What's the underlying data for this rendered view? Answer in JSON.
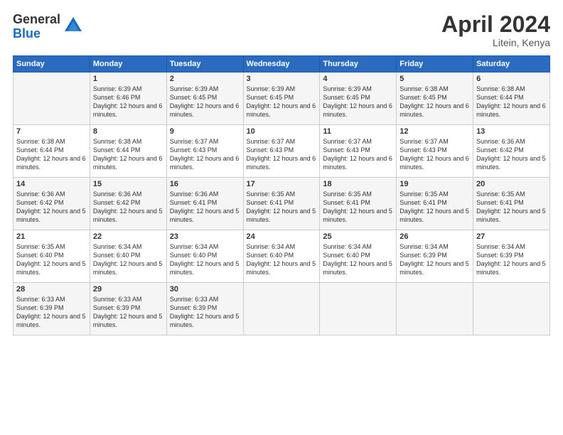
{
  "logo": {
    "general": "General",
    "blue": "Blue"
  },
  "title": "April 2024",
  "location": "Litein, Kenya",
  "weekdays": [
    "Sunday",
    "Monday",
    "Tuesday",
    "Wednesday",
    "Thursday",
    "Friday",
    "Saturday"
  ],
  "weeks": [
    [
      {
        "day": "",
        "sunrise": "",
        "sunset": "",
        "daylight": ""
      },
      {
        "day": "1",
        "sunrise": "Sunrise: 6:39 AM",
        "sunset": "Sunset: 6:46 PM",
        "daylight": "Daylight: 12 hours and 6 minutes."
      },
      {
        "day": "2",
        "sunrise": "Sunrise: 6:39 AM",
        "sunset": "Sunset: 6:45 PM",
        "daylight": "Daylight: 12 hours and 6 minutes."
      },
      {
        "day": "3",
        "sunrise": "Sunrise: 6:39 AM",
        "sunset": "Sunset: 6:45 PM",
        "daylight": "Daylight: 12 hours and 6 minutes."
      },
      {
        "day": "4",
        "sunrise": "Sunrise: 6:39 AM",
        "sunset": "Sunset: 6:45 PM",
        "daylight": "Daylight: 12 hours and 6 minutes."
      },
      {
        "day": "5",
        "sunrise": "Sunrise: 6:38 AM",
        "sunset": "Sunset: 6:45 PM",
        "daylight": "Daylight: 12 hours and 6 minutes."
      },
      {
        "day": "6",
        "sunrise": "Sunrise: 6:38 AM",
        "sunset": "Sunset: 6:44 PM",
        "daylight": "Daylight: 12 hours and 6 minutes."
      }
    ],
    [
      {
        "day": "7",
        "sunrise": "Sunrise: 6:38 AM",
        "sunset": "Sunset: 6:44 PM",
        "daylight": "Daylight: 12 hours and 6 minutes."
      },
      {
        "day": "8",
        "sunrise": "Sunrise: 6:38 AM",
        "sunset": "Sunset: 6:44 PM",
        "daylight": "Daylight: 12 hours and 6 minutes."
      },
      {
        "day": "9",
        "sunrise": "Sunrise: 6:37 AM",
        "sunset": "Sunset: 6:43 PM",
        "daylight": "Daylight: 12 hours and 6 minutes."
      },
      {
        "day": "10",
        "sunrise": "Sunrise: 6:37 AM",
        "sunset": "Sunset: 6:43 PM",
        "daylight": "Daylight: 12 hours and 6 minutes."
      },
      {
        "day": "11",
        "sunrise": "Sunrise: 6:37 AM",
        "sunset": "Sunset: 6:43 PM",
        "daylight": "Daylight: 12 hours and 6 minutes."
      },
      {
        "day": "12",
        "sunrise": "Sunrise: 6:37 AM",
        "sunset": "Sunset: 6:43 PM",
        "daylight": "Daylight: 12 hours and 6 minutes."
      },
      {
        "day": "13",
        "sunrise": "Sunrise: 6:36 AM",
        "sunset": "Sunset: 6:42 PM",
        "daylight": "Daylight: 12 hours and 5 minutes."
      }
    ],
    [
      {
        "day": "14",
        "sunrise": "Sunrise: 6:36 AM",
        "sunset": "Sunset: 6:42 PM",
        "daylight": "Daylight: 12 hours and 5 minutes."
      },
      {
        "day": "15",
        "sunrise": "Sunrise: 6:36 AM",
        "sunset": "Sunset: 6:42 PM",
        "daylight": "Daylight: 12 hours and 5 minutes."
      },
      {
        "day": "16",
        "sunrise": "Sunrise: 6:36 AM",
        "sunset": "Sunset: 6:41 PM",
        "daylight": "Daylight: 12 hours and 5 minutes."
      },
      {
        "day": "17",
        "sunrise": "Sunrise: 6:35 AM",
        "sunset": "Sunset: 6:41 PM",
        "daylight": "Daylight: 12 hours and 5 minutes."
      },
      {
        "day": "18",
        "sunrise": "Sunrise: 6:35 AM",
        "sunset": "Sunset: 6:41 PM",
        "daylight": "Daylight: 12 hours and 5 minutes."
      },
      {
        "day": "19",
        "sunrise": "Sunrise: 6:35 AM",
        "sunset": "Sunset: 6:41 PM",
        "daylight": "Daylight: 12 hours and 5 minutes."
      },
      {
        "day": "20",
        "sunrise": "Sunrise: 6:35 AM",
        "sunset": "Sunset: 6:41 PM",
        "daylight": "Daylight: 12 hours and 5 minutes."
      }
    ],
    [
      {
        "day": "21",
        "sunrise": "Sunrise: 6:35 AM",
        "sunset": "Sunset: 6:40 PM",
        "daylight": "Daylight: 12 hours and 5 minutes."
      },
      {
        "day": "22",
        "sunrise": "Sunrise: 6:34 AM",
        "sunset": "Sunset: 6:40 PM",
        "daylight": "Daylight: 12 hours and 5 minutes."
      },
      {
        "day": "23",
        "sunrise": "Sunrise: 6:34 AM",
        "sunset": "Sunset: 6:40 PM",
        "daylight": "Daylight: 12 hours and 5 minutes."
      },
      {
        "day": "24",
        "sunrise": "Sunrise: 6:34 AM",
        "sunset": "Sunset: 6:40 PM",
        "daylight": "Daylight: 12 hours and 5 minutes."
      },
      {
        "day": "25",
        "sunrise": "Sunrise: 6:34 AM",
        "sunset": "Sunset: 6:40 PM",
        "daylight": "Daylight: 12 hours and 5 minutes."
      },
      {
        "day": "26",
        "sunrise": "Sunrise: 6:34 AM",
        "sunset": "Sunset: 6:39 PM",
        "daylight": "Daylight: 12 hours and 5 minutes."
      },
      {
        "day": "27",
        "sunrise": "Sunrise: 6:34 AM",
        "sunset": "Sunset: 6:39 PM",
        "daylight": "Daylight: 12 hours and 5 minutes."
      }
    ],
    [
      {
        "day": "28",
        "sunrise": "Sunrise: 6:33 AM",
        "sunset": "Sunset: 6:39 PM",
        "daylight": "Daylight: 12 hours and 5 minutes."
      },
      {
        "day": "29",
        "sunrise": "Sunrise: 6:33 AM",
        "sunset": "Sunset: 6:39 PM",
        "daylight": "Daylight: 12 hours and 5 minutes."
      },
      {
        "day": "30",
        "sunrise": "Sunrise: 6:33 AM",
        "sunset": "Sunset: 6:39 PM",
        "daylight": "Daylight: 12 hours and 5 minutes."
      },
      {
        "day": "",
        "sunrise": "",
        "sunset": "",
        "daylight": ""
      },
      {
        "day": "",
        "sunrise": "",
        "sunset": "",
        "daylight": ""
      },
      {
        "day": "",
        "sunrise": "",
        "sunset": "",
        "daylight": ""
      },
      {
        "day": "",
        "sunrise": "",
        "sunset": "",
        "daylight": ""
      }
    ]
  ]
}
